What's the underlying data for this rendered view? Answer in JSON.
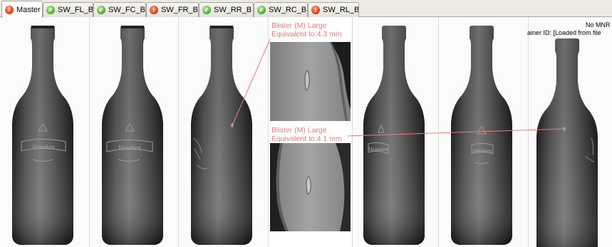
{
  "tabs": [
    {
      "label": "Master",
      "status": "fail",
      "active": true
    },
    {
      "label": "SW_FL_B",
      "status": "pass",
      "active": false
    },
    {
      "label": "SW_FC_B",
      "status": "pass",
      "active": false
    },
    {
      "label": "SW_FR_B",
      "status": "fail",
      "active": false
    },
    {
      "label": "SW_RR_B",
      "status": "pass",
      "active": false
    },
    {
      "label": "SW_RC_B",
      "status": "pass",
      "active": false
    },
    {
      "label": "SW_RL_B",
      "status": "fail",
      "active": false
    }
  ],
  "overlay": {
    "line1": "No MNR",
    "line2": "ainer ID: [Loaded from file"
  },
  "defects": [
    {
      "label": "Blister (M) Large",
      "equivalent": "Equivalent to:4.3 mm"
    },
    {
      "label": "Blister (M) Large",
      "equivalent": "Equivalent to:4.1 mm"
    }
  ],
  "bottle_labels": [
    "Heineken",
    "Heineken",
    "Heineken",
    "Heineken",
    "Heineken",
    "Heineken"
  ],
  "colors": {
    "fail": "#d9360f",
    "pass": "#4aa52a",
    "annotation": "#f07c7c",
    "glass": "#3f3f3f"
  }
}
